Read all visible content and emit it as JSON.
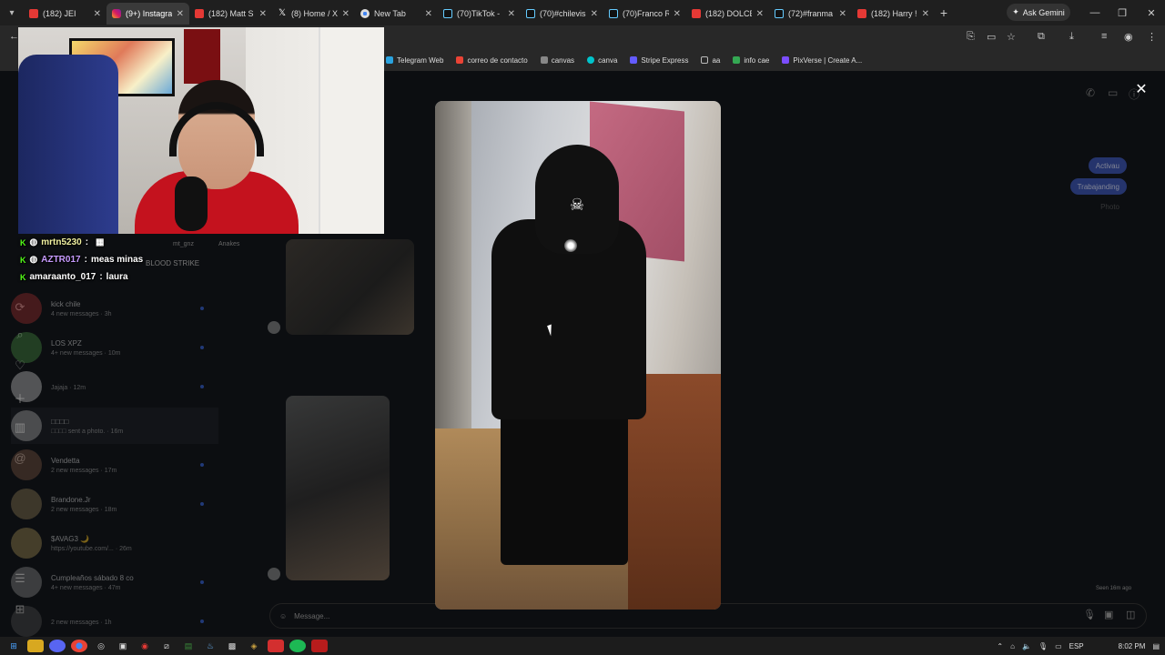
{
  "browser": {
    "tabs": [
      {
        "label": "(182) JEI",
        "icon": "youtube-icon",
        "active": false
      },
      {
        "label": "(9+) Instagram",
        "icon": "instagram-icon",
        "active": true
      },
      {
        "label": "(182) Matt S",
        "icon": "youtube-icon",
        "active": false
      },
      {
        "label": "(8) Home / X",
        "icon": "x-icon",
        "active": false
      },
      {
        "label": "New Tab",
        "icon": "chrome-icon",
        "active": false
      },
      {
        "label": "(70)TikTok -",
        "icon": "tiktok-icon",
        "active": false
      },
      {
        "label": "(70)#chilevis",
        "icon": "tiktok-icon",
        "active": false
      },
      {
        "label": "(70)Franco R",
        "icon": "tiktok-icon",
        "active": false
      },
      {
        "label": "(182) DOLCE",
        "icon": "youtube-icon",
        "active": false
      },
      {
        "label": "(72)#franma",
        "icon": "tiktok-icon",
        "active": false
      },
      {
        "label": "(182) Harry !",
        "icon": "youtube-icon",
        "active": false
      }
    ],
    "ask_gemini": "Ask Gemini",
    "bookmarks": [
      {
        "label": "Telegram Web",
        "color": "#2aa3df"
      },
      {
        "label": "correo de contacto",
        "color": "#ea4335"
      },
      {
        "label": "canvas",
        "color": "#888888"
      },
      {
        "label": "canva",
        "color": "#00c4cc"
      },
      {
        "label": "Stripe Express",
        "color": "#635bff"
      },
      {
        "label": "aa",
        "color": "#bbbbbb"
      },
      {
        "label": "info cae",
        "color": "#34a853"
      },
      {
        "label": "PixVerse | Create A...",
        "color": "#7b4dff"
      }
    ]
  },
  "stream_chat": [
    {
      "user": "mrtn5230",
      "message": ""
    },
    {
      "user": "AZTR017",
      "message": "meas minas"
    },
    {
      "user": "amaraanto_017",
      "message": "laura"
    }
  ],
  "instagram": {
    "top_list_labels": [
      "mt_gnz",
      "Anakes"
    ],
    "blood_strike": "BLOOD STRIKE",
    "conversations": [
      {
        "name": "kick chile",
        "sub": "4 new messages · 3h"
      },
      {
        "name": "LOS XPZ",
        "sub": "4+ new messages · 10m"
      },
      {
        "name": "",
        "sub": "Jajaja · 12m"
      },
      {
        "name": "□□□□",
        "sub": "□□□□ sent a photo. · 16m"
      },
      {
        "name": "Vendetta",
        "sub": "2 new messages · 17m"
      },
      {
        "name": "Brandone.Jr",
        "sub": "2 new messages · 18m"
      },
      {
        "name": "$AVAG3 🌙",
        "sub": "https://youtube.com/... · 26m"
      },
      {
        "name": "Cumpleaños sábado 8 co",
        "sub": "4+ new messages · 47m"
      },
      {
        "name": "",
        "sub": "2 new messages · 1h"
      }
    ],
    "bubbles": [
      "Activau",
      "Trabajanding",
      "Photo"
    ],
    "seen": "Seen 16m ago",
    "composer_placeholder": "Message..."
  },
  "taskbar": {
    "lang": "ESP",
    "time": "8:02 PM"
  }
}
